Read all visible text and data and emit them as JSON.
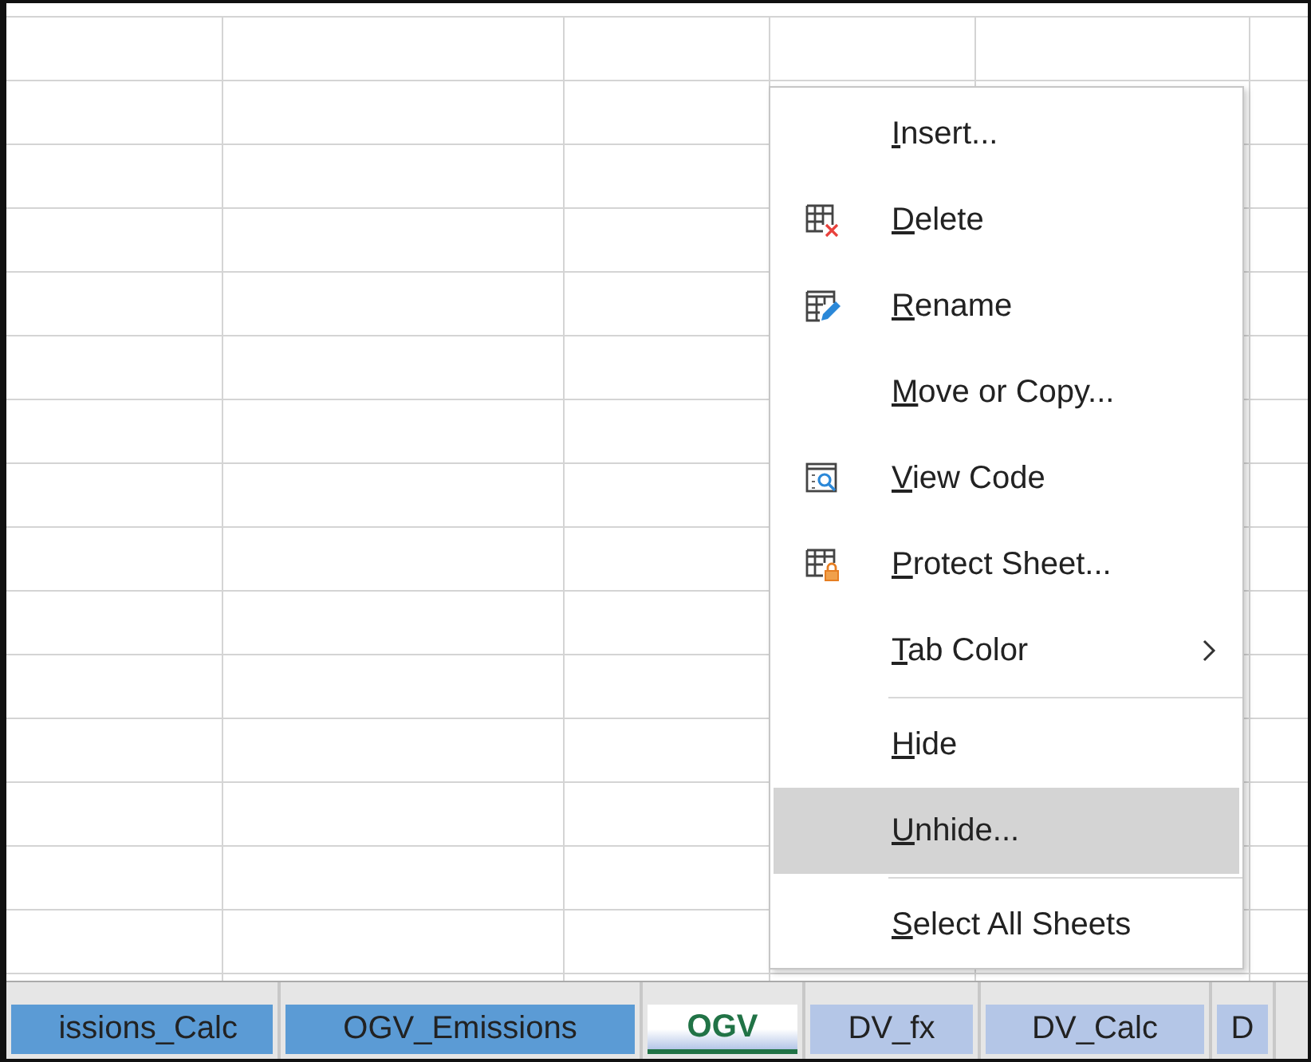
{
  "context_menu": {
    "items": [
      {
        "kind": "item",
        "label": "Insert...",
        "accel": true,
        "selected": false
      },
      {
        "kind": "item",
        "label": "Delete",
        "accel": true,
        "selected": false
      },
      {
        "kind": "item",
        "label": "Rename",
        "accel": true,
        "selected": false
      },
      {
        "kind": "item",
        "label": "Move or Copy...",
        "accel": true,
        "selected": false
      },
      {
        "kind": "item",
        "label": "View Code",
        "accel": true,
        "selected": false
      },
      {
        "kind": "item",
        "label": "Protect Sheet...",
        "accel": true,
        "selected": false
      },
      {
        "kind": "submenu",
        "label": "Tab Color",
        "accel": true,
        "selected": false
      },
      {
        "kind": "separator"
      },
      {
        "kind": "item",
        "label": "Hide",
        "accel": true,
        "selected": false
      },
      {
        "kind": "item",
        "label": "Unhide...",
        "accel": true,
        "selected": true
      },
      {
        "kind": "separator"
      },
      {
        "kind": "item",
        "label": "Select All Sheets",
        "accel": true,
        "selected": false
      }
    ]
  },
  "sheet_tabs": [
    {
      "label": "issions_Calc",
      "selected": false,
      "color": "#5b9bd5"
    },
    {
      "label": "OGV_Emissions",
      "selected": false,
      "color": "#5b9bd5"
    },
    {
      "label": "OGV",
      "selected": true,
      "color": "#b4c6e7"
    },
    {
      "label": "DV_fx",
      "selected": false,
      "color": "#b4c6e7"
    },
    {
      "label": "DV_Calc",
      "selected": false,
      "color": "#b4c6e7"
    },
    {
      "label": "D",
      "selected": false,
      "color": "#b4c6e7"
    }
  ]
}
